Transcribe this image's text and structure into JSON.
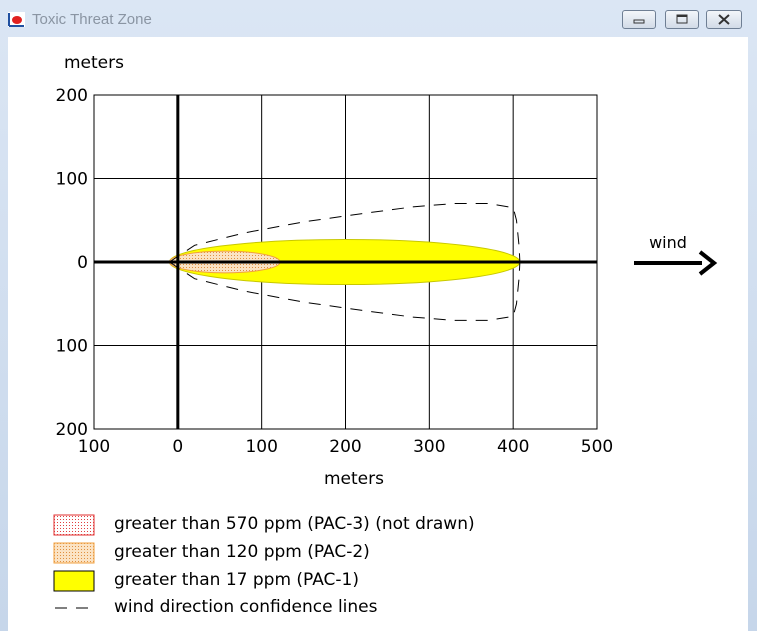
{
  "window": {
    "title": "Toxic Threat Zone",
    "icons": {
      "app": "chart-app-icon",
      "minimize": "minimize-icon",
      "maximize": "maximize-icon",
      "close": "close-icon"
    }
  },
  "chart_data": {
    "type": "area",
    "ylabel": "meters",
    "xlabel": "meters",
    "xlim": [
      -100,
      500
    ],
    "ylim": [
      -200,
      200
    ],
    "x_ticks": [
      -100,
      0,
      100,
      200,
      300,
      400,
      500
    ],
    "x_tick_labels": [
      "100",
      "0",
      "100",
      "200",
      "300",
      "400",
      "500"
    ],
    "y_ticks": [
      200,
      100,
      0,
      -100,
      -200
    ],
    "y_tick_labels": [
      "200",
      "100",
      "0",
      "100",
      "200"
    ],
    "grid": true,
    "wind_label": "wind",
    "zones": [
      {
        "name": "greater than 120 ppm (PAC-2)",
        "x_start": -10,
        "x_end": 122,
        "half_width": 13,
        "color": "#fad7a7"
      },
      {
        "name": "greater than 17 ppm (PAC-1)",
        "x_start": -10,
        "x_end": 408,
        "half_width": 27,
        "color": "#ffff00"
      }
    ],
    "confidence_lines": {
      "upper": [
        [
          -10,
          0
        ],
        [
          20,
          20
        ],
        [
          80,
          35
        ],
        [
          150,
          48
        ],
        [
          220,
          58
        ],
        [
          280,
          66
        ],
        [
          330,
          70
        ],
        [
          370,
          70
        ],
        [
          400,
          65
        ],
        [
          404,
          50
        ],
        [
          407,
          20
        ],
        [
          408,
          0
        ]
      ],
      "lower": [
        [
          -10,
          0
        ],
        [
          20,
          -20
        ],
        [
          80,
          -35
        ],
        [
          150,
          -48
        ],
        [
          220,
          -58
        ],
        [
          280,
          -66
        ],
        [
          330,
          -70
        ],
        [
          370,
          -70
        ],
        [
          400,
          -65
        ],
        [
          404,
          -50
        ],
        [
          407,
          -20
        ],
        [
          408,
          0
        ]
      ]
    },
    "legend": [
      {
        "label": "greater than 570 ppm (PAC-3) (not drawn)",
        "swatch": "dotted-red"
      },
      {
        "label": "greater than 120 ppm (PAC-2)",
        "swatch": "dotted-orange"
      },
      {
        "label": "greater than 17 ppm (PAC-1)",
        "swatch": "yellow"
      },
      {
        "label": "wind direction confidence lines",
        "swatch": "dashed-line"
      }
    ]
  }
}
